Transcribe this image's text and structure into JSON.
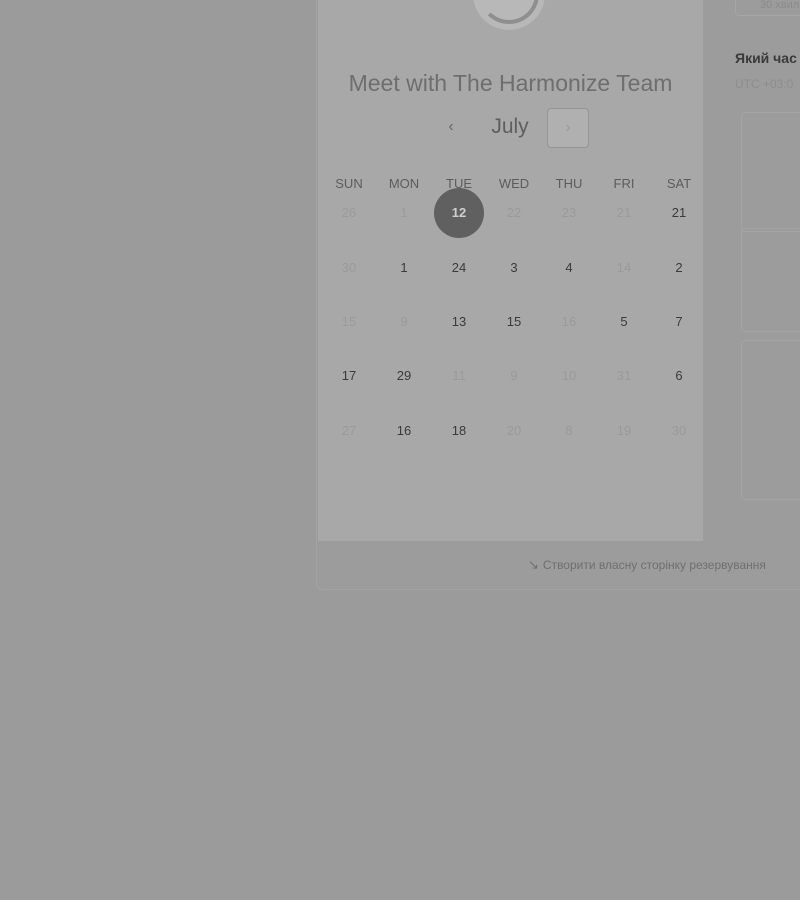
{
  "widget": {
    "logo_icon": "chat-bubble-dots-icon",
    "logo_dots": "•••",
    "title": "Meet with The Harmonize Team",
    "month": "July",
    "prev_icon": "chevron-left-icon",
    "next_icon": "chevron-right-icon",
    "prev_glyph": "‹",
    "next_glyph": "›",
    "weekdays": [
      "SUN",
      "MON",
      "TUE",
      "WED",
      "THU",
      "FRI",
      "SAT"
    ],
    "weeks": [
      [
        {
          "label": "26",
          "available": false
        },
        {
          "label": "1",
          "available": false
        },
        {
          "label": "12",
          "available": true,
          "selected": true
        },
        {
          "label": "22",
          "available": false
        },
        {
          "label": "23",
          "available": false
        },
        {
          "label": "21",
          "available": false
        },
        {
          "label": "21",
          "available": true
        }
      ],
      [
        {
          "label": "30",
          "available": false
        },
        {
          "label": "1",
          "available": true
        },
        {
          "label": "24",
          "available": true
        },
        {
          "label": "3",
          "available": true
        },
        {
          "label": "4",
          "available": true
        },
        {
          "label": "14",
          "available": false
        },
        {
          "label": "2",
          "available": true
        }
      ],
      [
        {
          "label": "15",
          "available": false
        },
        {
          "label": "9",
          "available": false
        },
        {
          "label": "13",
          "available": true
        },
        {
          "label": "15",
          "available": true
        },
        {
          "label": "16",
          "available": false
        },
        {
          "label": "5",
          "available": true
        },
        {
          "label": "7",
          "available": true
        }
      ],
      [
        {
          "label": "17",
          "available": true
        },
        {
          "label": "29",
          "available": true
        },
        {
          "label": "11",
          "available": false
        },
        {
          "label": "9",
          "available": false
        },
        {
          "label": "10",
          "available": false
        },
        {
          "label": "31",
          "available": false
        },
        {
          "label": "6",
          "available": true
        }
      ],
      [
        {
          "label": "27",
          "available": false
        },
        {
          "label": "16",
          "available": true
        },
        {
          "label": "18",
          "available": true
        },
        {
          "label": "20",
          "available": false
        },
        {
          "label": "8",
          "available": false
        },
        {
          "label": "19",
          "available": false
        },
        {
          "label": "30",
          "available": false
        }
      ]
    ]
  },
  "side": {
    "duration": "30 хвил",
    "question": "Який час",
    "timezone": "UTC +03:0"
  },
  "footer": {
    "link_icon": "cursor-sparkle-icon",
    "link_glyph": "↘",
    "link_text": "Створити власну сторінку резервування"
  },
  "colors": {
    "overlay": "#9b9b9b",
    "card": "#a8a8a8",
    "selected_day": "#606060"
  }
}
